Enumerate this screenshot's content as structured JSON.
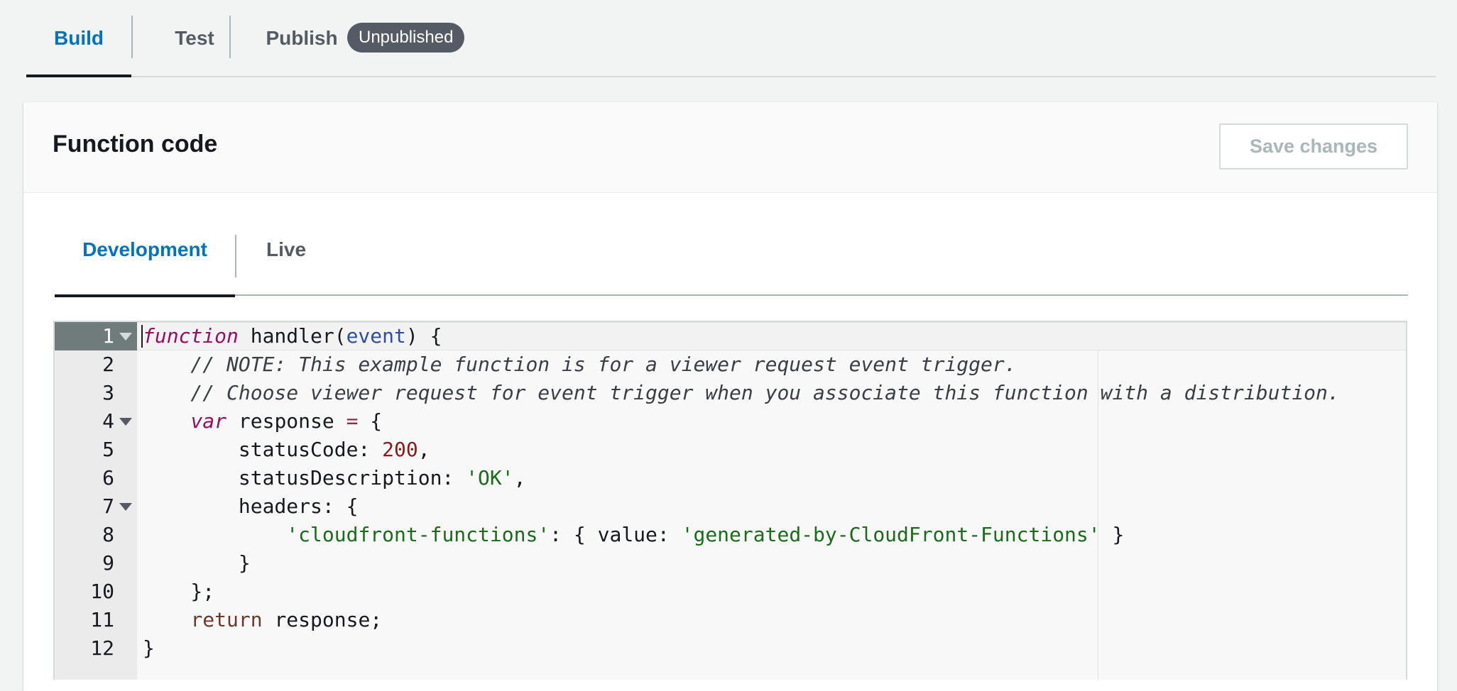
{
  "tabs": {
    "build": "Build",
    "test": "Test",
    "publish": "Publish",
    "status_badge": "Unpublished"
  },
  "card": {
    "title": "Function code",
    "save_button": "Save changes"
  },
  "code_tabs": {
    "development": "Development",
    "live": "Live"
  },
  "editor": {
    "line_numbers": [
      "1",
      "2",
      "3",
      "4",
      "5",
      "6",
      "7",
      "8",
      "9",
      "10",
      "11",
      "12"
    ],
    "lines": {
      "l1_kw": "function",
      "l1_a": " handler(",
      "l1_param": "event",
      "l1_b": ") {",
      "l2": "    // NOTE: This example function is for a viewer request event trigger.",
      "l3": "    // Choose viewer request for event trigger when you associate this function with a distribution.",
      "l4_indent": "    ",
      "l4_kw": "var",
      "l4_a": " response ",
      "l4_op": "=",
      "l4_b": " {",
      "l5_a": "        statusCode: ",
      "l5_num": "200",
      "l5_b": ",",
      "l6_a": "        statusDescription: ",
      "l6_str": "'OK'",
      "l6_b": ",",
      "l7": "        headers: {",
      "l8_indent": "            ",
      "l8_key": "'cloudfront-functions'",
      "l8_a": ": { value: ",
      "l8_str": "'generated-by-CloudFront-Functions'",
      "l8_b": " }",
      "l9": "        }",
      "l10": "    };",
      "l11_indent": "    ",
      "l11_kw": "return",
      "l11_a": " response;",
      "l12": "}"
    }
  }
}
